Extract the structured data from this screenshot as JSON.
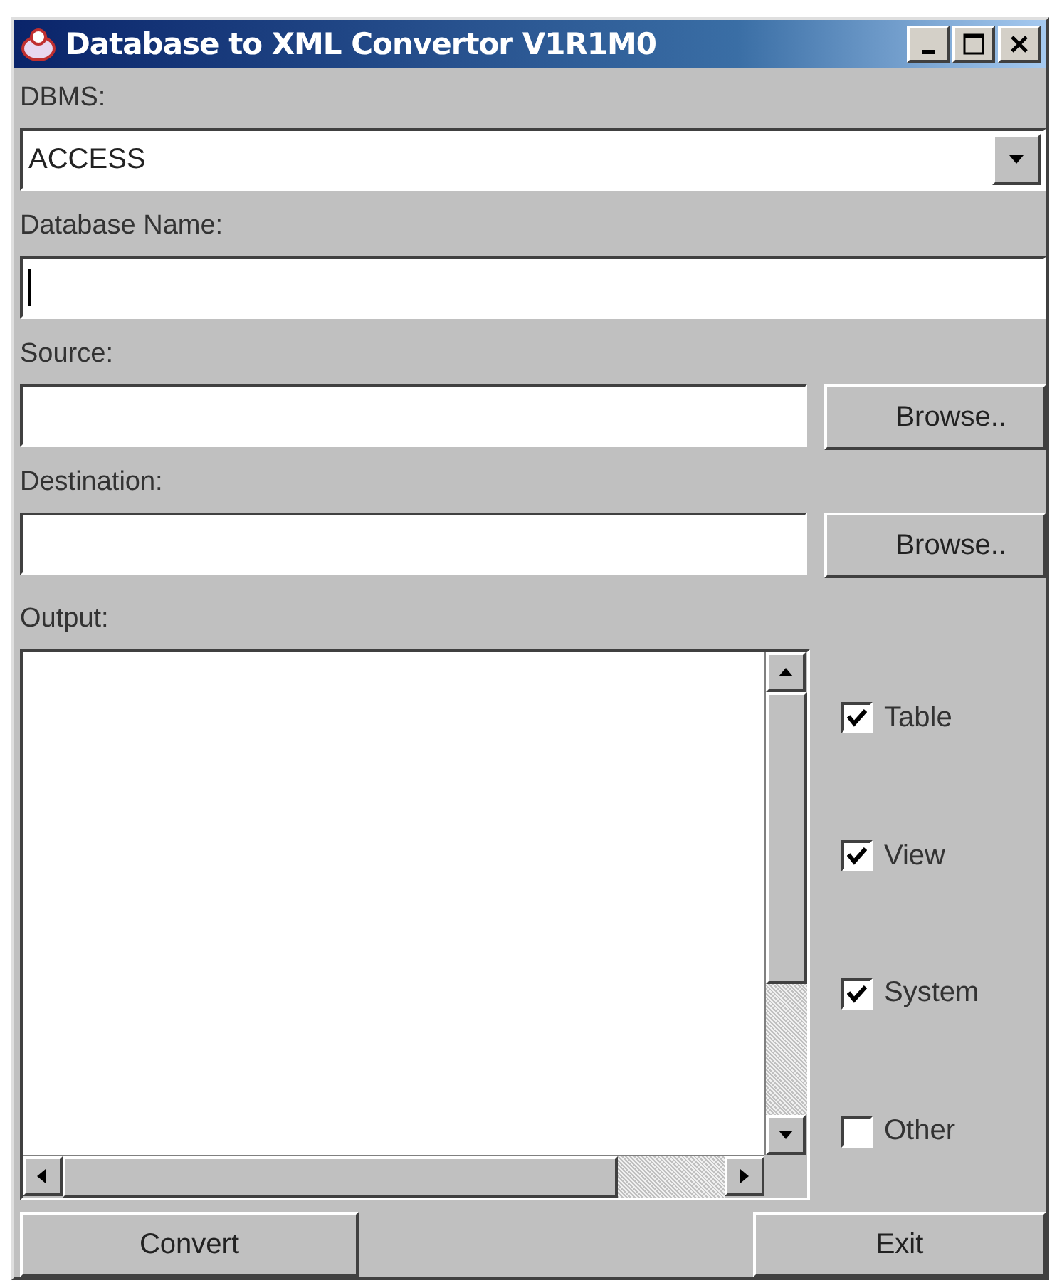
{
  "window": {
    "title": "Database to XML Convertor V1R1M0"
  },
  "dbms": {
    "label": "DBMS:",
    "value": "ACCESS"
  },
  "database_name": {
    "label": "Database Name:"
  },
  "source": {
    "label": "Source:",
    "button": "Browse.."
  },
  "destination": {
    "label": "Destination:",
    "button": "Browse.."
  },
  "output": {
    "label": "Output:"
  },
  "options": [
    {
      "label": "Table",
      "checked": true
    },
    {
      "label": "View",
      "checked": true
    },
    {
      "label": "System",
      "checked": true
    },
    {
      "label": "Other",
      "checked": false
    }
  ],
  "buttons": [
    "Convert",
    "Exit"
  ]
}
